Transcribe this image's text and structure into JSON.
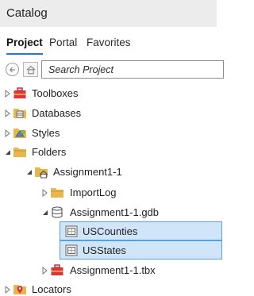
{
  "panel": {
    "title": "Catalog"
  },
  "tabs": [
    {
      "label": "Project",
      "active": true
    },
    {
      "label": "Portal",
      "active": false
    },
    {
      "label": "Favorites",
      "active": false
    }
  ],
  "search": {
    "placeholder": "Search Project"
  },
  "tree": [
    {
      "label": "Toolboxes",
      "icon": "toolbox-icon",
      "expanded": false,
      "selected": false
    },
    {
      "label": "Databases",
      "icon": "database-folder-icon",
      "expanded": false,
      "selected": false
    },
    {
      "label": "Styles",
      "icon": "styles-folder-icon",
      "expanded": false,
      "selected": false
    },
    {
      "label": "Folders",
      "icon": "folder-icon",
      "expanded": true,
      "selected": false
    },
    {
      "label": "Assignment1-1",
      "icon": "home-folder-icon",
      "expanded": true,
      "selected": false
    },
    {
      "label": "ImportLog",
      "icon": "folder-icon",
      "expanded": false,
      "selected": false
    },
    {
      "label": "Assignment1-1.gdb",
      "icon": "geodatabase-icon",
      "expanded": true,
      "selected": false
    },
    {
      "label": "USCounties",
      "icon": "feature-class-icon",
      "expanded": null,
      "selected": true
    },
    {
      "label": "USStates",
      "icon": "feature-class-icon",
      "expanded": null,
      "selected": true
    },
    {
      "label": "Assignment1-1.tbx",
      "icon": "toolbox-icon",
      "expanded": false,
      "selected": false
    },
    {
      "label": "Locators",
      "icon": "locators-folder-icon",
      "expanded": false,
      "selected": false
    }
  ],
  "colors": {
    "accent": "#1c7ae0",
    "selection_bg": "#d1e5f8",
    "selection_border": "#5aa0dc",
    "folder": "#e8b64a"
  }
}
